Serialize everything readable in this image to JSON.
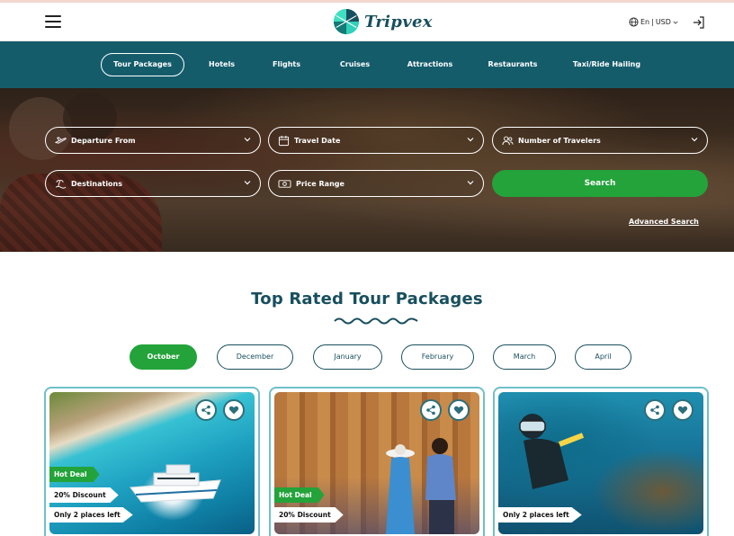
{
  "header": {
    "logo_text": "Tripvex",
    "lang": "En",
    "currency": "USD"
  },
  "nav": {
    "items": [
      {
        "label": "Tour Packages",
        "active": true
      },
      {
        "label": "Hotels"
      },
      {
        "label": "Flights"
      },
      {
        "label": "Cruises"
      },
      {
        "label": "Attractions"
      },
      {
        "label": "Restaurants"
      },
      {
        "label": "Taxi/Ride Hailing"
      }
    ]
  },
  "search": {
    "departure": "Departure From",
    "travel_date": "Travel Date",
    "travelers": "Number of Travelers",
    "destinations": "Destinations",
    "price_range": "Price Range",
    "button": "Search",
    "advanced": "Advanced Search"
  },
  "section": {
    "title": "Top Rated Tour Packages"
  },
  "months": [
    "October",
    "December",
    "January",
    "February",
    "March",
    "April"
  ],
  "cards": [
    {
      "image": "boat-beach",
      "tags": [
        "Hot Deal",
        "20% Discount",
        "Only 2 places left"
      ]
    },
    {
      "image": "egypt-temple",
      "tags": [
        "Hot Deal",
        "20% Discount"
      ]
    },
    {
      "image": "scuba-diver",
      "tags": [
        "Only 2 places left"
      ]
    }
  ],
  "colors": {
    "brand": "#184f5e",
    "nav_bg": "#155c6b",
    "accent_green": "#23a33a",
    "card_border": "#6fc1c7"
  }
}
